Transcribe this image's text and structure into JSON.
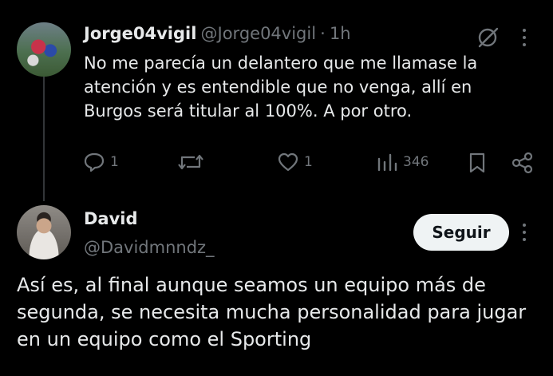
{
  "tweet": {
    "author_name": "Jorge04vigil",
    "handle": "@Jorge04vigil",
    "separator": "·",
    "time": "1h",
    "text": "No me parecía un delantero que me llamase la atención y es entendible que no venga, allí en Burgos será titular al 100%. A por otro.",
    "replies": "1",
    "reposts": "",
    "likes": "1",
    "views": "346"
  },
  "reply_author": {
    "name": "David",
    "handle": "@Davidmnndz_",
    "follow_label": "Seguir",
    "text": "Así es, al final aunque seamos un equipo más de segunda, se necesita mucha personalidad para jugar en un equipo como el Sporting"
  },
  "colors": {
    "background": "#000000",
    "text": "#e7e9ea",
    "muted": "#71767b",
    "button_bg": "#eff3f4"
  }
}
